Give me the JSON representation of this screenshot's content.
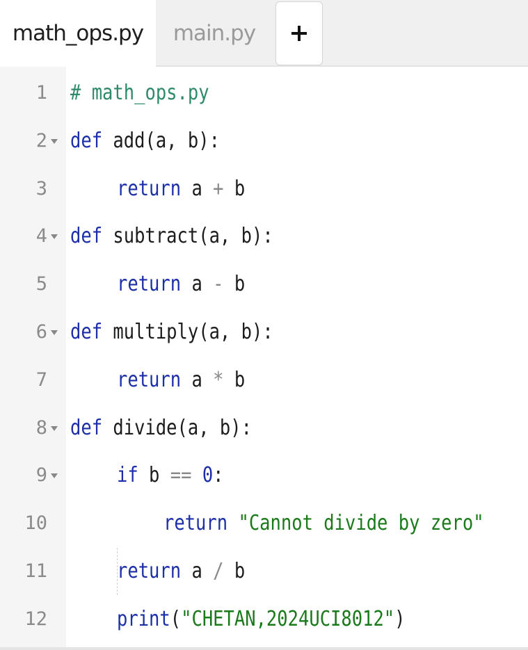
{
  "tabs": [
    {
      "label": "math_ops.py",
      "active": true
    },
    {
      "label": "main.py",
      "active": false
    }
  ],
  "add_tab_label": "+",
  "colors": {
    "keyword": "#1d2fa8",
    "comment": "#2e8a6b",
    "string": "#1a7a1a",
    "number": "#1d2fa8",
    "gutter_bg": "#f5f5f5",
    "line_number": "#8a8a8a"
  },
  "code_lines": [
    {
      "n": "1",
      "fold": false,
      "indent": 0,
      "tokens": [
        {
          "t": "# math_ops.py",
          "c": "cm"
        }
      ]
    },
    {
      "n": "2",
      "fold": true,
      "indent": 0,
      "tokens": [
        {
          "t": "def",
          "c": "kw"
        },
        {
          "t": " add(a, b):",
          "c": ""
        }
      ]
    },
    {
      "n": "3",
      "fold": false,
      "indent": 1,
      "tokens": [
        {
          "t": "return",
          "c": "kw"
        },
        {
          "t": " a ",
          "c": ""
        },
        {
          "t": "+",
          "c": "op"
        },
        {
          "t": " b",
          "c": ""
        }
      ]
    },
    {
      "n": "4",
      "fold": true,
      "indent": 0,
      "tokens": [
        {
          "t": "def",
          "c": "kw"
        },
        {
          "t": " subtract(a, b):",
          "c": ""
        }
      ]
    },
    {
      "n": "5",
      "fold": false,
      "indent": 1,
      "tokens": [
        {
          "t": "return",
          "c": "kw"
        },
        {
          "t": " a ",
          "c": ""
        },
        {
          "t": "-",
          "c": "op"
        },
        {
          "t": " b",
          "c": ""
        }
      ]
    },
    {
      "n": "6",
      "fold": true,
      "indent": 0,
      "tokens": [
        {
          "t": "def",
          "c": "kw"
        },
        {
          "t": " multiply(a, b):",
          "c": ""
        }
      ]
    },
    {
      "n": "7",
      "fold": false,
      "indent": 1,
      "tokens": [
        {
          "t": "return",
          "c": "kw"
        },
        {
          "t": " a ",
          "c": ""
        },
        {
          "t": "*",
          "c": "op"
        },
        {
          "t": " b",
          "c": ""
        }
      ]
    },
    {
      "n": "8",
      "fold": true,
      "indent": 0,
      "tokens": [
        {
          "t": "def",
          "c": "kw"
        },
        {
          "t": " divide(a, b):",
          "c": ""
        }
      ]
    },
    {
      "n": "9",
      "fold": true,
      "indent": 1,
      "tokens": [
        {
          "t": "if",
          "c": "kw"
        },
        {
          "t": " b ",
          "c": ""
        },
        {
          "t": "==",
          "c": "op"
        },
        {
          "t": " ",
          "c": ""
        },
        {
          "t": "0",
          "c": "nm"
        },
        {
          "t": ":",
          "c": ""
        }
      ]
    },
    {
      "n": "10",
      "fold": false,
      "indent": 2,
      "tokens": [
        {
          "t": "return",
          "c": "kw"
        },
        {
          "t": " ",
          "c": ""
        },
        {
          "t": "\"Cannot divide by zero\"",
          "c": "st"
        }
      ]
    },
    {
      "n": "11",
      "fold": false,
      "indent": 1,
      "tokens": [
        {
          "t": "return",
          "c": "kw"
        },
        {
          "t": " a ",
          "c": ""
        },
        {
          "t": "/",
          "c": "op"
        },
        {
          "t": " b",
          "c": ""
        }
      ]
    },
    {
      "n": "12",
      "fold": false,
      "indent": 1,
      "tokens": [
        {
          "t": "print",
          "c": "kw"
        },
        {
          "t": "(",
          "c": ""
        },
        {
          "t": "\"CHETAN,2024UCI8012\"",
          "c": "st"
        },
        {
          "t": ")",
          "c": ""
        }
      ]
    }
  ]
}
